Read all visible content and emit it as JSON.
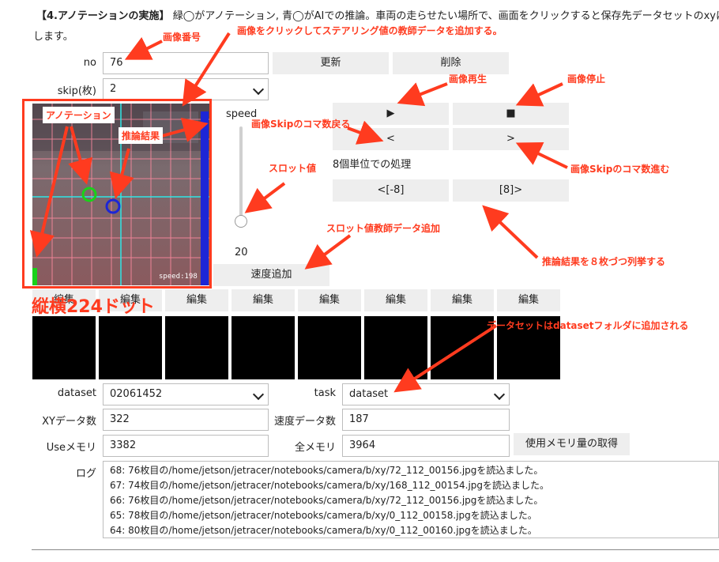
{
  "header": {
    "title": "【4.アノテーションの実施】",
    "desc1": "緑◯がアノテーション, 青◯がAIでの推論。車両の走らせたい場所で、画面をクリックすると保存先データセットのxyに追",
    "desc2": "します。"
  },
  "no": {
    "label": "no",
    "value": "76"
  },
  "buttons": {
    "update": "更新",
    "delete": "削除",
    "play": "▶",
    "stop": "■",
    "prev": "<",
    "next": ">",
    "prev8": "<[-8]",
    "next8": "[8]>",
    "speed_add": "速度追加",
    "mem_fetch": "使用メモリ量の取得",
    "edit": [
      "編集",
      "編集",
      "編集",
      "編集",
      "編集",
      "編集",
      "編集",
      "編集"
    ]
  },
  "skip": {
    "label": "skip(枚)",
    "value": "2"
  },
  "speed": {
    "label": "speed",
    "value": "20",
    "level": 0.2
  },
  "batch_text": "8個単位での処理",
  "camera": {
    "overlay": "speed:198"
  },
  "dataset": {
    "label": "dataset",
    "value": "02061452"
  },
  "task": {
    "label": "task",
    "value": "dataset"
  },
  "xy_count": {
    "label": "XYデータ数",
    "value": "322"
  },
  "speed_count": {
    "label": "速度データ数",
    "value": "187"
  },
  "use_mem": {
    "label": "Useメモリ",
    "value": "3382"
  },
  "all_mem": {
    "label": "全メモリ",
    "value": "3964"
  },
  "log": {
    "label": "ログ",
    "lines": [
      "68: 76枚目の/home/jetson/jetracer/notebooks/camera/b/xy/72_112_00156.jpgを読込ました。",
      "67: 74枚目の/home/jetson/jetracer/notebooks/camera/b/xy/168_112_00154.jpgを読込ました。",
      "66: 76枚目の/home/jetson/jetracer/notebooks/camera/b/xy/72_112_00156.jpgを読込ました。",
      "65: 78枚目の/home/jetson/jetracer/notebooks/camera/b/xy/0_112_00158.jpgを読込ました。",
      "64: 80枚目の/home/jetson/jetracer/notebooks/camera/b/xy/0_112_00160.jpgを読込ました。"
    ]
  },
  "annotations": {
    "image_no": "画像番号",
    "click_add": "画像をクリックしてステアリング値の教師データを追加する。",
    "annotation": "アノテーション",
    "inference": "推論結果",
    "play": "画像再生",
    "stop": "画像停止",
    "skip_back": "画像Skipのコマ数戻る",
    "skip_fwd": "画像Skipのコマ数進む",
    "slot_value": "スロット値",
    "slot_add": "スロット値教師データ追加",
    "infer_list": "推論結果を８枚づつ列挙する",
    "dataset_folder": "データセットはdatasetフォルダに追加される",
    "size": "縦横224ドット"
  },
  "colors": {
    "annotation_red": "#ff3b1f",
    "green_circle": "#19d219",
    "blue_circle": "#1d26d6",
    "cyan_line": "#2ee6e6"
  }
}
